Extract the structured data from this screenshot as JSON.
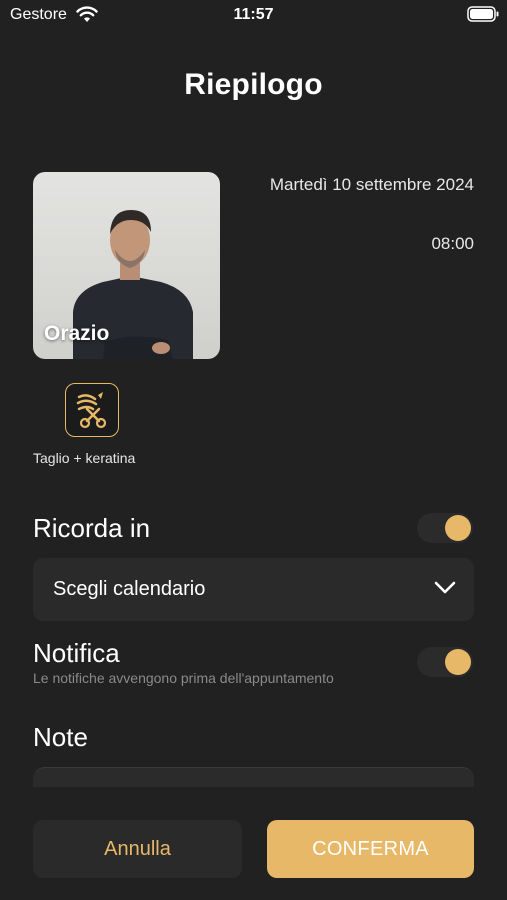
{
  "status_bar": {
    "carrier": "Gestore",
    "time": "11:57"
  },
  "header": {
    "title": "Riepilogo"
  },
  "staff": {
    "name": "Orazio"
  },
  "appointment": {
    "date": "Martedì 10 settembre 2024",
    "time": "08:00"
  },
  "service": {
    "label": "Taglio + keratina",
    "icon": "scissors-hair-icon"
  },
  "reminder": {
    "label": "Ricorda in",
    "enabled": true,
    "calendar_select": "Scegli calendario"
  },
  "notification": {
    "label": "Notifica",
    "subtitle": "Le notifiche avvengono prima dell'appuntamento",
    "enabled": true
  },
  "notes": {
    "label": "Note"
  },
  "actions": {
    "cancel_label": "Annulla",
    "confirm_label": "CONFERMA"
  },
  "colors": {
    "background": "#212121",
    "accent": "#e7b868",
    "surface": "#2a2a2a"
  }
}
